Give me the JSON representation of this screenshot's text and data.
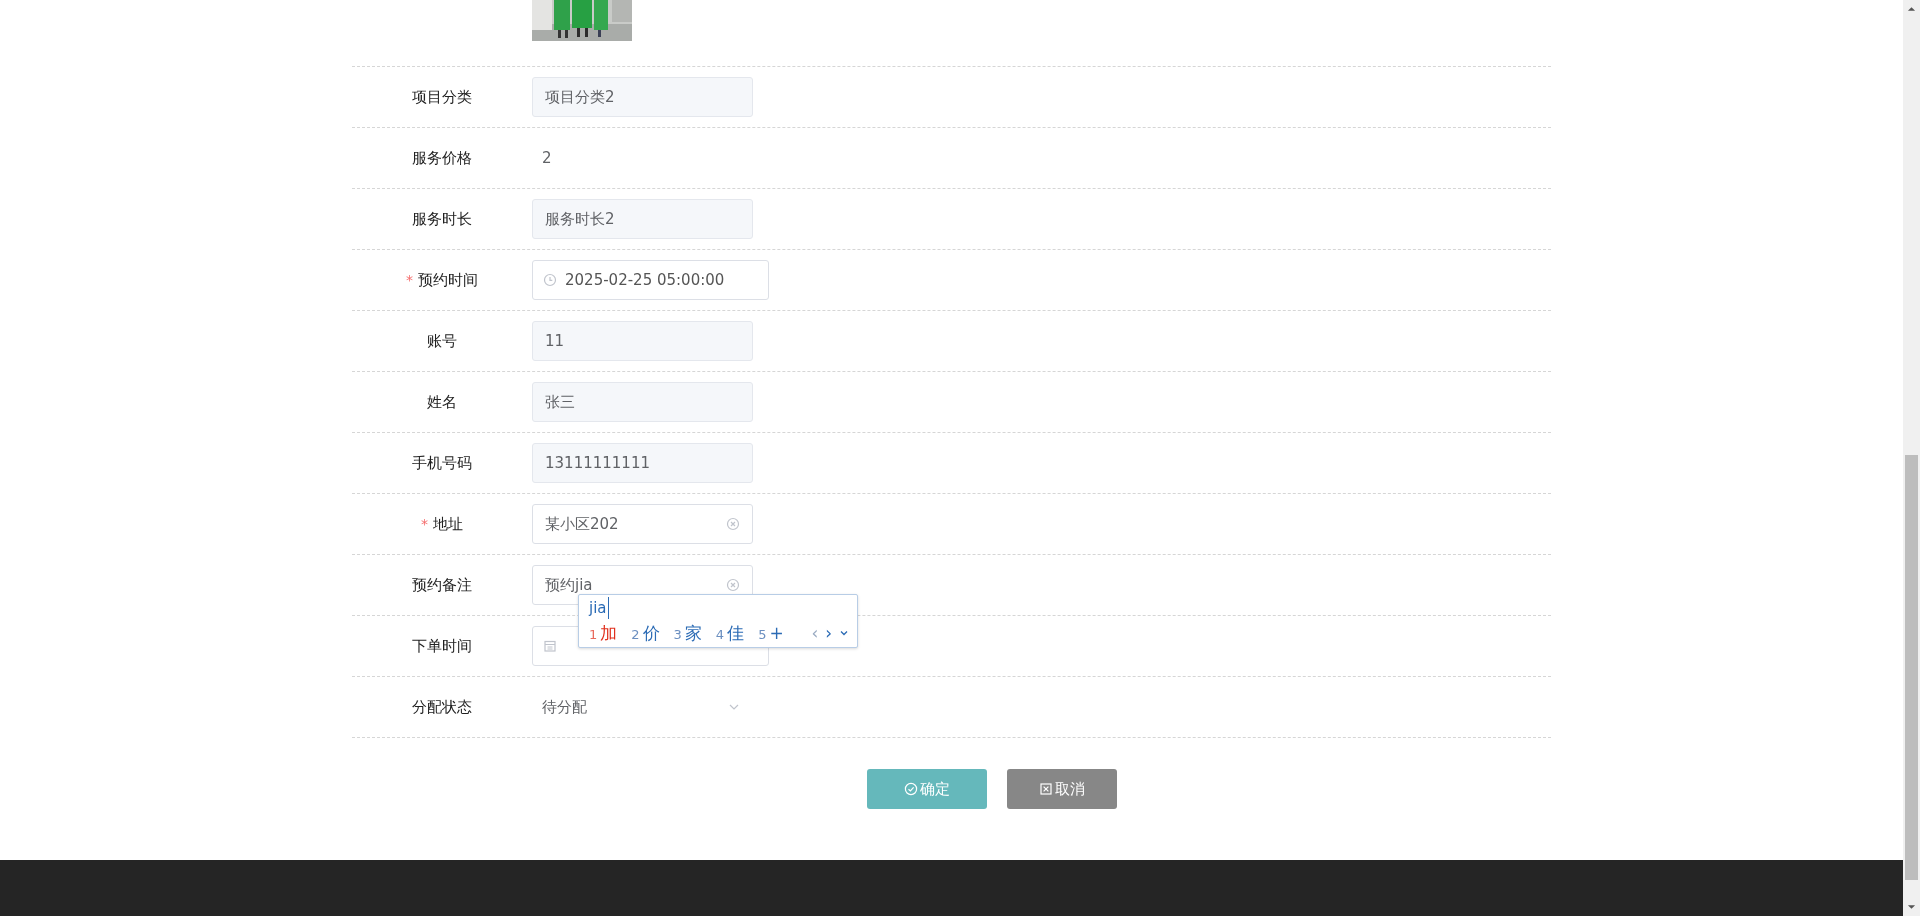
{
  "fields": [
    {
      "label": "项目分类",
      "kind": "readonly",
      "value": "项目分类2"
    },
    {
      "label": "服务价格",
      "kind": "text",
      "value": "2"
    },
    {
      "label": "服务时长",
      "kind": "readonly",
      "value": "服务时长2"
    },
    {
      "required_mark": "*",
      "label": "预约时间",
      "kind": "datetime",
      "value": "2025-02-25 05:00:00"
    },
    {
      "label": "账号",
      "kind": "readonly",
      "value": "11"
    },
    {
      "label": "姓名",
      "kind": "readonly",
      "value": "张三"
    },
    {
      "label": "手机号码",
      "kind": "readonly",
      "value": "13111111111"
    },
    {
      "required_mark": "*",
      "label": "地址",
      "kind": "clearable",
      "value": "某小区202"
    },
    {
      "label": "预约备注",
      "kind": "clearable",
      "value": "预约jia"
    },
    {
      "label": "下单时间",
      "kind": "date"
    },
    {
      "label": "分配状态",
      "kind": "select",
      "value": "待分配"
    }
  ],
  "ime": {
    "composition": "jia",
    "candidates": [
      {
        "index": "1",
        "text": "加",
        "selected": true
      },
      {
        "index": "2",
        "text": "价",
        "selected": false
      },
      {
        "index": "3",
        "text": "家",
        "selected": false
      },
      {
        "index": "4",
        "text": "佳",
        "selected": false
      },
      {
        "index": "5",
        "text": "+",
        "selected": false
      }
    ],
    "nav": [
      {
        "glyph": "‹",
        "disabled": true
      },
      {
        "glyph": "›",
        "disabled": false
      }
    ]
  },
  "buttons": [
    {
      "kind": "confirm",
      "label": "确定"
    },
    {
      "kind": "cancel",
      "label": "取消"
    }
  ]
}
